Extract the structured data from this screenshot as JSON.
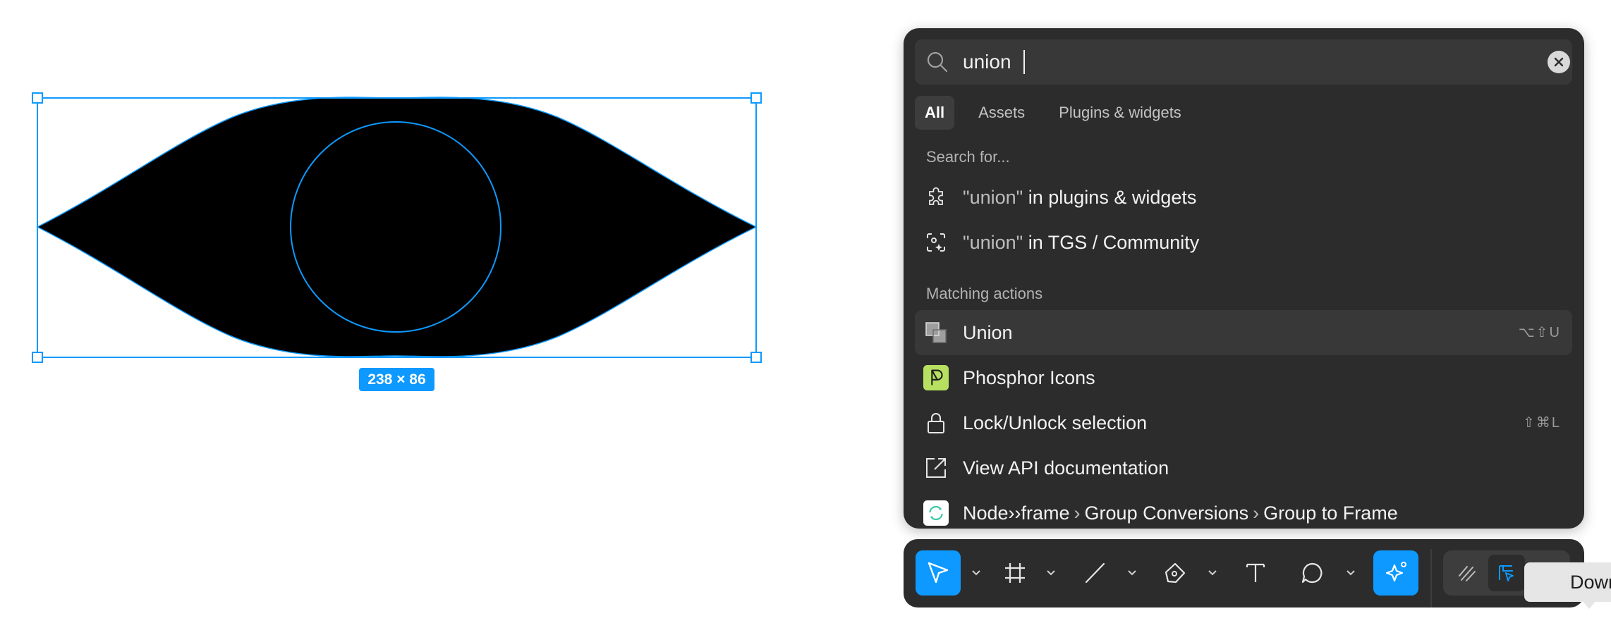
{
  "canvas": {
    "size_label": "238 × 86"
  },
  "quick_actions": {
    "search": {
      "value": "union",
      "placeholder": ""
    },
    "tabs": [
      {
        "label": "All",
        "active": true
      },
      {
        "label": "Assets",
        "active": false
      },
      {
        "label": "Plugins & widgets",
        "active": false
      }
    ],
    "search_for_header": "Search for...",
    "search_for": [
      {
        "icon": "puzzle-icon",
        "query": "\"union\"",
        "suffix": " in plugins & widgets"
      },
      {
        "icon": "community-icon",
        "query": "\"union\"",
        "suffix": " in TGS / Community"
      }
    ],
    "matching_header": "Matching actions",
    "actions": [
      {
        "icon": "union-icon",
        "label": "Union",
        "shortcut": "⌥⇧U",
        "selected": true
      },
      {
        "icon": "phosphor-plugin-icon",
        "label": "Phosphor Icons",
        "shortcut": "",
        "selected": false
      },
      {
        "icon": "lock-icon",
        "label": "Lock/Unlock selection",
        "shortcut": "⇧⌘L",
        "selected": false
      },
      {
        "icon": "external-link-icon",
        "label": "View API documentation",
        "shortcut": "",
        "selected": false
      }
    ],
    "plugin_path": {
      "icon": "node-frame-plugin-icon",
      "plugin": "Node››frame",
      "category": "Group Conversions",
      "command": "Group to Frame"
    }
  },
  "toolbar": {
    "tools": [
      {
        "name": "move-tool",
        "icon": "cursor-icon",
        "active": true
      },
      {
        "name": "frame-tool",
        "icon": "frame-hash-icon",
        "active": false
      },
      {
        "name": "line-tool",
        "icon": "line-icon",
        "active": false
      },
      {
        "name": "pen-tool",
        "icon": "pen-icon",
        "active": false
      },
      {
        "name": "text-tool",
        "icon": "text-icon",
        "active": false
      },
      {
        "name": "comment-tool",
        "icon": "comment-icon",
        "active": false
      },
      {
        "name": "ai-tool",
        "icon": "sparkle-cursor-icon",
        "active": true
      }
    ],
    "modes": [
      {
        "name": "draw-mode",
        "icon": "draw-icon"
      },
      {
        "name": "design-mode",
        "icon": "design-icon",
        "active": true
      }
    ],
    "tooltip": "Downlo"
  },
  "colors": {
    "accent": "#0d99ff",
    "panel_bg": "#2c2c2c",
    "plugin_green": "#b8e060"
  }
}
